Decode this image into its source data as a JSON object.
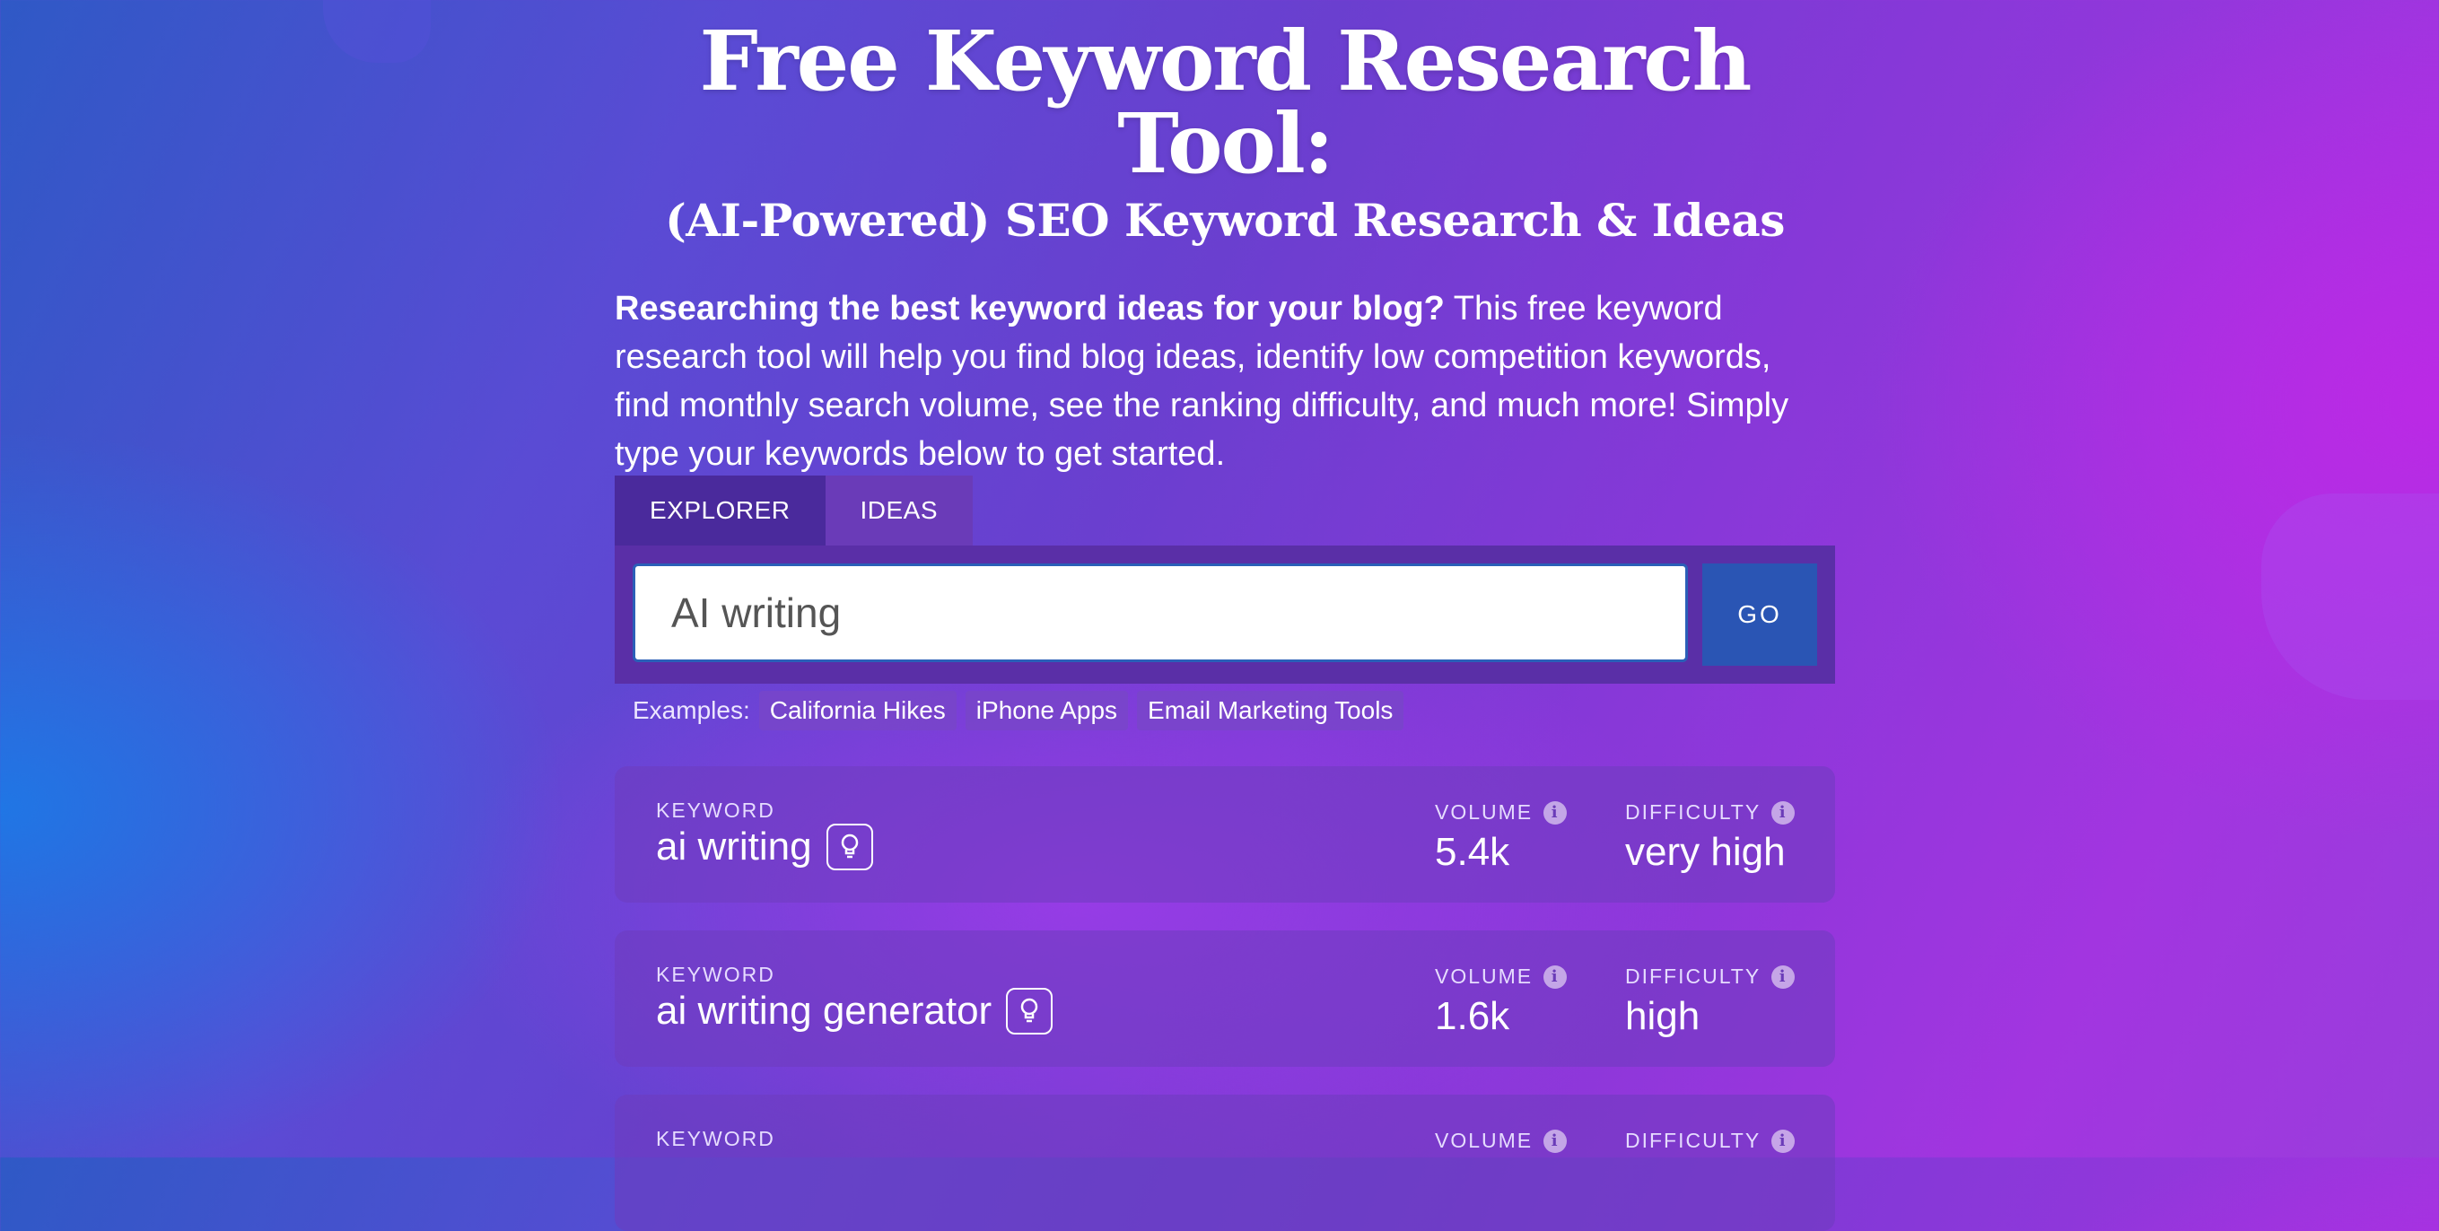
{
  "header": {
    "title": "Free Keyword Research Tool:",
    "subtitle": "(AI-Powered) SEO Keyword Research & Ideas"
  },
  "intro": {
    "bold": "Researching the best keyword ideas for your blog?",
    "text": " This free keyword research tool will help you find blog ideas, identify low competition keywords, find monthly search volume, see the ranking difficulty, and much more! Simply type your keywords below to get started."
  },
  "tabs": [
    {
      "label": "EXPLORER",
      "active": true
    },
    {
      "label": "IDEAS",
      "active": false
    }
  ],
  "search": {
    "value": "AI writing",
    "go_label": "GO"
  },
  "examples": {
    "label": "Examples:",
    "items": [
      "California Hikes",
      "iPhone Apps",
      "Email Marketing Tools"
    ]
  },
  "results": {
    "keyword_label": "KEYWORD",
    "volume_label": "VOLUME",
    "difficulty_label": "DIFFICULTY",
    "info_glyph": "i",
    "rows": [
      {
        "keyword": "ai writing",
        "volume": "5.4k",
        "difficulty": "very high"
      },
      {
        "keyword": "ai writing generator",
        "volume": "1.6k",
        "difficulty": "high"
      },
      {
        "keyword": "",
        "volume": "",
        "difficulty": ""
      }
    ]
  },
  "colors": {
    "active_tab": "#4a2a9c",
    "go_button": "#2a55b4",
    "input_border": "#2b5fb8"
  },
  "icons": {
    "bulb": "lightbulb-icon",
    "info": "info-icon"
  }
}
